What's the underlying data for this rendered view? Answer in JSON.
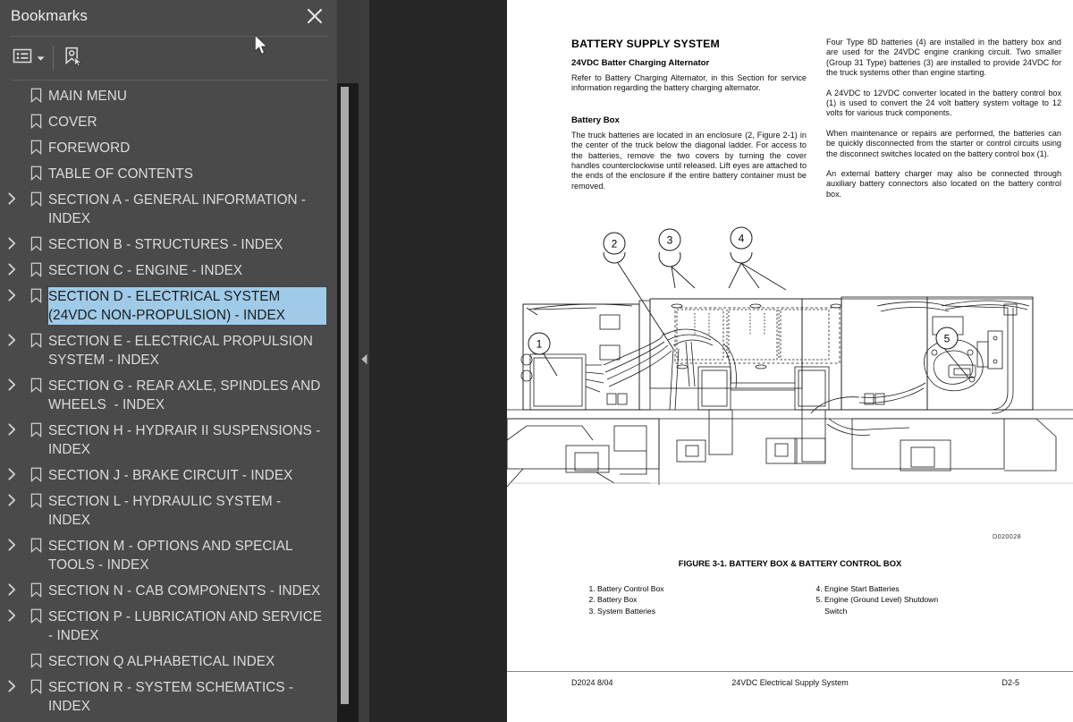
{
  "sidebar": {
    "title": "Bookmarks",
    "close_icon": "close-icon",
    "toolbar": {
      "list_options_icon": "list-options-icon",
      "list_options_caret": "chevron-down-icon",
      "bookmark_current_icon": "new-bookmark-icon"
    },
    "items": [
      {
        "label": "MAIN MENU",
        "expandable": false,
        "selected": false
      },
      {
        "label": "COVER",
        "expandable": false,
        "selected": false
      },
      {
        "label": "FOREWORD",
        "expandable": false,
        "selected": false
      },
      {
        "label": "TABLE OF CONTENTS",
        "expandable": false,
        "selected": false
      },
      {
        "label": "SECTION A - GENERAL INFORMATION - INDEX",
        "expandable": true,
        "selected": false
      },
      {
        "label": "SECTION B - STRUCTURES - INDEX",
        "expandable": true,
        "selected": false
      },
      {
        "label": "SECTION C - ENGINE - INDEX",
        "expandable": true,
        "selected": false
      },
      {
        "label": "SECTION D - ELECTRICAL SYSTEM (24VDC NON-PROPULSION) - INDEX",
        "expandable": true,
        "selected": true
      },
      {
        "label": "SECTION E - ELECTRICAL PROPULSION SYSTEM - INDEX",
        "expandable": true,
        "selected": false
      },
      {
        "label": "SECTION G - REAR AXLE, SPINDLES AND WHEELS  - INDEX",
        "expandable": true,
        "selected": false
      },
      {
        "label": "SECTION H - HYDRAIR II SUSPENSIONS - INDEX",
        "expandable": true,
        "selected": false
      },
      {
        "label": "SECTION J - BRAKE CIRCUIT - INDEX",
        "expandable": true,
        "selected": false
      },
      {
        "label": "SECTION L - HYDRAULIC SYSTEM - INDEX",
        "expandable": true,
        "selected": false
      },
      {
        "label": "SECTION M - OPTIONS AND SPECIAL TOOLS - INDEX",
        "expandable": true,
        "selected": false
      },
      {
        "label": "SECTION N - CAB COMPONENTS - INDEX",
        "expandable": true,
        "selected": false
      },
      {
        "label": "SECTION P - LUBRICATION AND SERVICE - INDEX",
        "expandable": true,
        "selected": false
      },
      {
        "label": "SECTION Q ALPHABETICAL INDEX",
        "expandable": false,
        "selected": false
      },
      {
        "label": "SECTION R - SYSTEM SCHEMATICS - INDEX",
        "expandable": true,
        "selected": false
      }
    ],
    "collapse_handle_icon": "collapse-panel-icon",
    "scrollbar": "vertical-scrollbar"
  },
  "document": {
    "title": "BATTERY SUPPLY SYSTEM",
    "left_column": {
      "sub1": "24VDC Batter Charging Alternator",
      "p1": "Refer to Battery Charging Alternator, in this Section for service information regarding the battery charging alternator.",
      "sub2": "Battery Box",
      "p2": "The truck batteries are located in an enclosure (2, Figure 2-1) in the center of the truck below the diagonal ladder. For access to the batteries, remove the two covers by turning the cover handles counterclockwise until released. Lift eyes are attached to the ends of the enclosure if the entire battery container must be removed."
    },
    "right_column": {
      "p1": "Four Type 8D batteries (4) are installed in the battery box and are used for the 24VDC engine cranking circuit. Two smaller (Group 31 Type) batteries (3) are installed to provide 24VDC for the truck systems other than engine starting.",
      "p2": "A 24VDC to 12VDC converter located in the battery control box (1) is used to convert the 24 volt battery system voltage to 12 volts for various truck components.",
      "p3": "When maintenance or repairs are performed, the batteries can be quickly disconnected from the starter or control circuits using the disconnect switches located on the battery control box (1).",
      "p4": "An external battery charger may also be connected through auxiliary battery connectors also located on the battery control box."
    },
    "figure": {
      "drawing_code": "D020028",
      "caption": "FIGURE 3-1. BATTERY BOX & BATTERY CONTROL BOX",
      "callouts": [
        "1",
        "2",
        "3",
        "4",
        "5"
      ],
      "legend_left": [
        "1. Battery Control Box",
        "2. Battery Box",
        "3. System Batteries"
      ],
      "legend_right": [
        "4. Engine Start Batteries",
        "5. Engine (Ground Level) Shutdown\n    Switch"
      ]
    },
    "footer": {
      "left": "D2024  8/04",
      "center": "24VDC Electrical Supply System",
      "right": "D2-5"
    }
  },
  "colors": {
    "sidebar_bg": "#4a4a4a",
    "viewer_bg": "#262626",
    "selection": "#9fcbe8",
    "page_bg": "#ffffff"
  }
}
